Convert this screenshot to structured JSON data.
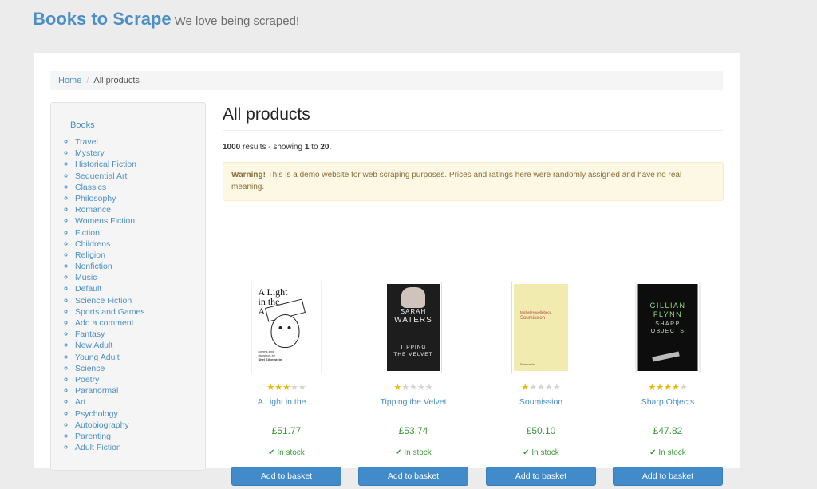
{
  "header": {
    "brand": "Books to Scrape",
    "tagline": "We love being scraped!"
  },
  "breadcrumb": {
    "home": "Home",
    "separator": "/",
    "current": "All products"
  },
  "sidebar": {
    "title": "Books",
    "categories": [
      "Travel",
      "Mystery",
      "Historical Fiction",
      "Sequential Art",
      "Classics",
      "Philosophy",
      "Romance",
      "Womens Fiction",
      "Fiction",
      "Childrens",
      "Religion",
      "Nonfiction",
      "Music",
      "Default",
      "Science Fiction",
      "Sports and Games",
      "Add a comment",
      "Fantasy",
      "New Adult",
      "Young Adult",
      "Science",
      "Poetry",
      "Paranormal",
      "Art",
      "Psychology",
      "Autobiography",
      "Parenting",
      "Adult Fiction"
    ]
  },
  "main": {
    "title": "All products",
    "results": {
      "total": "1000",
      "text1": " results - showing ",
      "from": "1",
      "text2": " to ",
      "to": "20",
      "text3": "."
    },
    "warning": {
      "label": "Warning!",
      "text": " This is a demo website for web scraping purposes. Prices and ratings here were randomly assigned and have no real meaning."
    }
  },
  "products": [
    {
      "title": "A Light in the ...",
      "rating": 3,
      "price": "£51.77",
      "availability": "In stock",
      "button": "Add to basket",
      "cover_text": [
        "A Light",
        "in the",
        "Attic"
      ],
      "cover_small": [
        "poems and",
        "drawings by",
        "Shel Silverstein"
      ]
    },
    {
      "title": "Tipping the Velvet",
      "rating": 1,
      "price": "£53.74",
      "availability": "In stock",
      "button": "Add to basket",
      "cover_text": [
        "SARAH",
        "WATERS",
        "TIPPING",
        "THE VELVET"
      ]
    },
    {
      "title": "Soumission",
      "rating": 1,
      "price": "£50.10",
      "availability": "In stock",
      "button": "Add to basket",
      "cover_text": [
        "Michel Houellebecq",
        "Soumission",
        "Flammarion"
      ]
    },
    {
      "title": "Sharp Objects",
      "rating": 4,
      "price": "£47.82",
      "availability": "In stock",
      "button": "Add to basket",
      "cover_text": [
        "GILLIAN",
        "FLYNN",
        "SHARP",
        "OBJECTS"
      ]
    }
  ],
  "icons": {
    "star": "★",
    "check": "✔"
  },
  "colors": {
    "brand": "#4c8fc6",
    "price": "#3c9a3c",
    "button": "#428bca",
    "star_on": "#e6b800",
    "star_off": "#d4d4d4",
    "warning_bg": "#fcf8e3"
  }
}
